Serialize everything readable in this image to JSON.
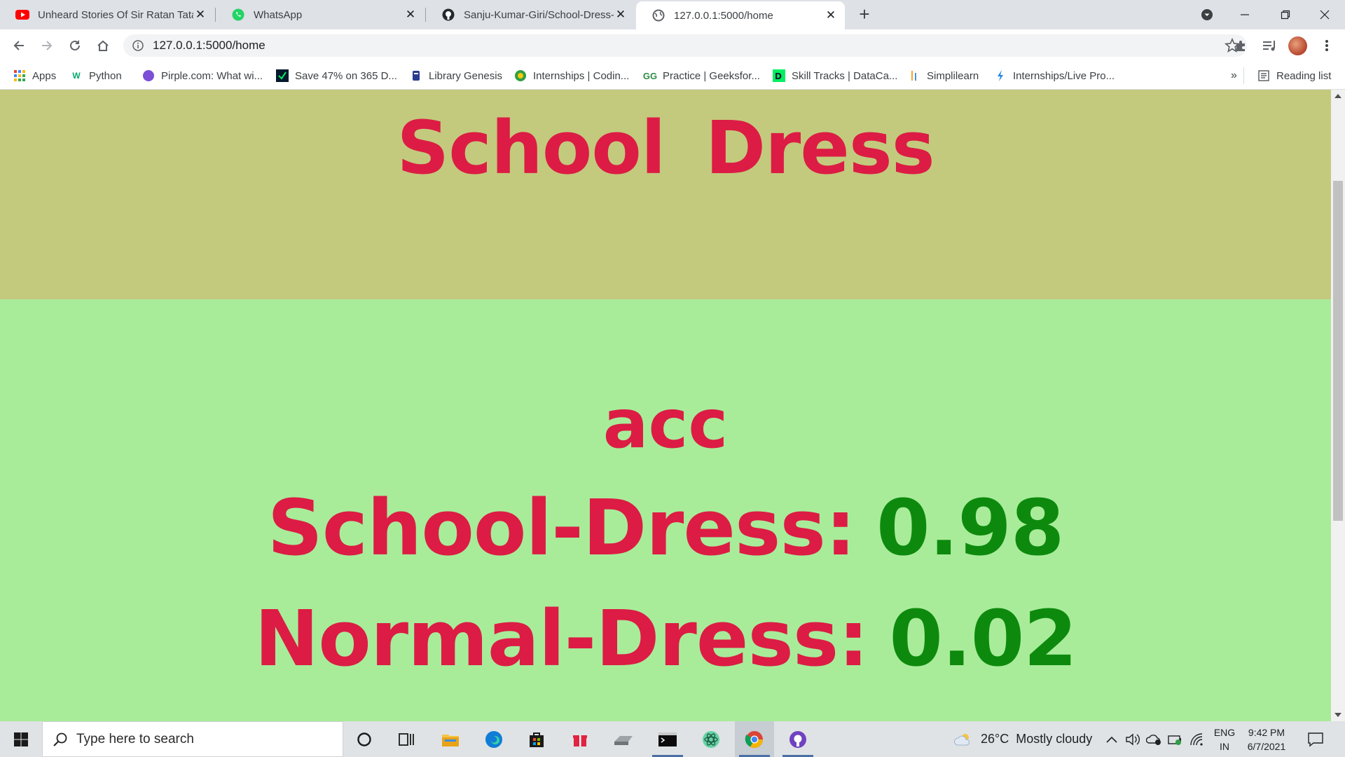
{
  "browser": {
    "tabs": [
      {
        "title": "Unheard Stories Of Sir Ratan Tata",
        "favicon": "youtube-icon",
        "active": false
      },
      {
        "title": "WhatsApp",
        "favicon": "whatsapp-icon",
        "active": false
      },
      {
        "title": "Sanju-Kumar-Giri/School-Dress-\\",
        "favicon": "github-icon",
        "active": false
      },
      {
        "title": "127.0.0.1:5000/home",
        "favicon": "globe-icon",
        "active": true
      }
    ],
    "address": "127.0.0.1:5000/home",
    "bookmarks": [
      {
        "label": "Apps",
        "icon": "apps-grid-icon"
      },
      {
        "label": "Python",
        "icon": "w3schools-icon"
      },
      {
        "label": "Pirple.com: What wi...",
        "icon": "pirple-icon"
      },
      {
        "label": "Save 47% on 365 D...",
        "icon": "datacamp-icon"
      },
      {
        "label": "Library Genesis",
        "icon": "libgen-icon"
      },
      {
        "label": "Internships | Codin...",
        "icon": "internship-icon"
      },
      {
        "label": "Practice | Geeksfor...",
        "icon": "geeksforgeeks-icon"
      },
      {
        "label": "Skill Tracks | DataCa...",
        "icon": "datacamp-skill-icon"
      },
      {
        "label": "Simplilearn",
        "icon": "simplilearn-icon"
      },
      {
        "label": "Internships/Live Pro...",
        "icon": "live-project-icon"
      }
    ],
    "overflow_label": "»",
    "reading_list_label": "Reading list"
  },
  "page": {
    "title": "School Dress",
    "result_label": "acc",
    "results": [
      {
        "label": "School-Dress:",
        "value": "0.98"
      },
      {
        "label": "Normal-Dress:",
        "value": "0.02"
      }
    ],
    "colors": {
      "header_bg": "#c3ca7d",
      "main_bg": "#a8ec9a",
      "label_color": "#dc1c44",
      "value_color": "#0d8a0d"
    }
  },
  "taskbar": {
    "search_placeholder": "Type here to search",
    "weather": "26°C  Mostly cloudy",
    "language_top": "ENG",
    "language_bottom": "IN",
    "time": "9:42 PM",
    "date": "6/7/2021"
  }
}
